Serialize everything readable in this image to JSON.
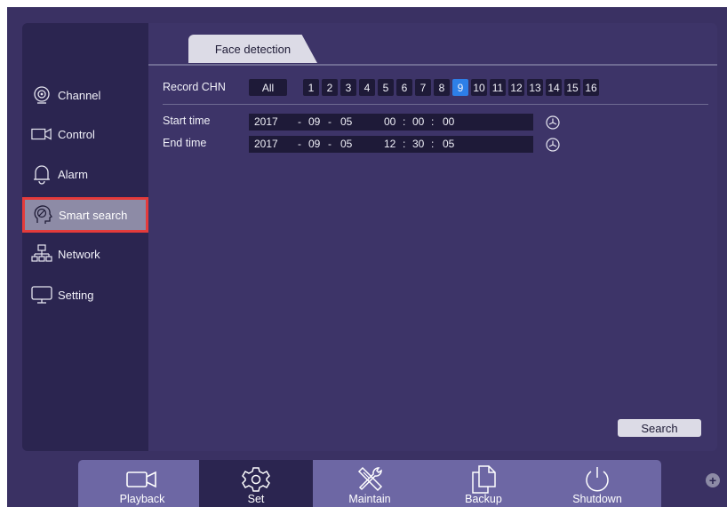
{
  "sidebar": {
    "items": [
      {
        "label": "Channel",
        "icon": "channel-icon"
      },
      {
        "label": "Control",
        "icon": "camera-icon"
      },
      {
        "label": "Alarm",
        "icon": "bell-icon"
      },
      {
        "label": "Smart search",
        "icon": "head-icon"
      },
      {
        "label": "Network",
        "icon": "network-icon"
      },
      {
        "label": "Setting",
        "icon": "monitor-icon"
      }
    ],
    "active": "Smart search"
  },
  "tabs": {
    "active": "Face detection"
  },
  "record": {
    "label": "Record CHN",
    "all_label": "All",
    "channels": [
      "1",
      "2",
      "3",
      "4",
      "5",
      "6",
      "7",
      "8",
      "9",
      "10",
      "11",
      "12",
      "13",
      "14",
      "15",
      "16"
    ],
    "selected": "9"
  },
  "start": {
    "label": "Start time",
    "year": "2017",
    "month": "09",
    "day": "05",
    "hour": "00",
    "minute": "00",
    "second": "00",
    "sep_date": "-",
    "sep_time": ":"
  },
  "end": {
    "label": "End time",
    "year": "2017",
    "month": "09",
    "day": "05",
    "hour": "12",
    "minute": "30",
    "second": "05",
    "sep_date": "-",
    "sep_time": ":"
  },
  "search_label": "Search",
  "bottom": {
    "items": [
      {
        "label": "Playback",
        "icon": "camera-icon"
      },
      {
        "label": "Set",
        "icon": "gear-icon"
      },
      {
        "label": "Maintain",
        "icon": "tools-icon"
      },
      {
        "label": "Backup",
        "icon": "copy-icon"
      },
      {
        "label": "Shutdown",
        "icon": "power-icon"
      }
    ],
    "active": "Set"
  },
  "colors": {
    "background": "#3a3163",
    "selected_channel": "#2d7fe8",
    "highlight_border": "#e43b3b"
  }
}
